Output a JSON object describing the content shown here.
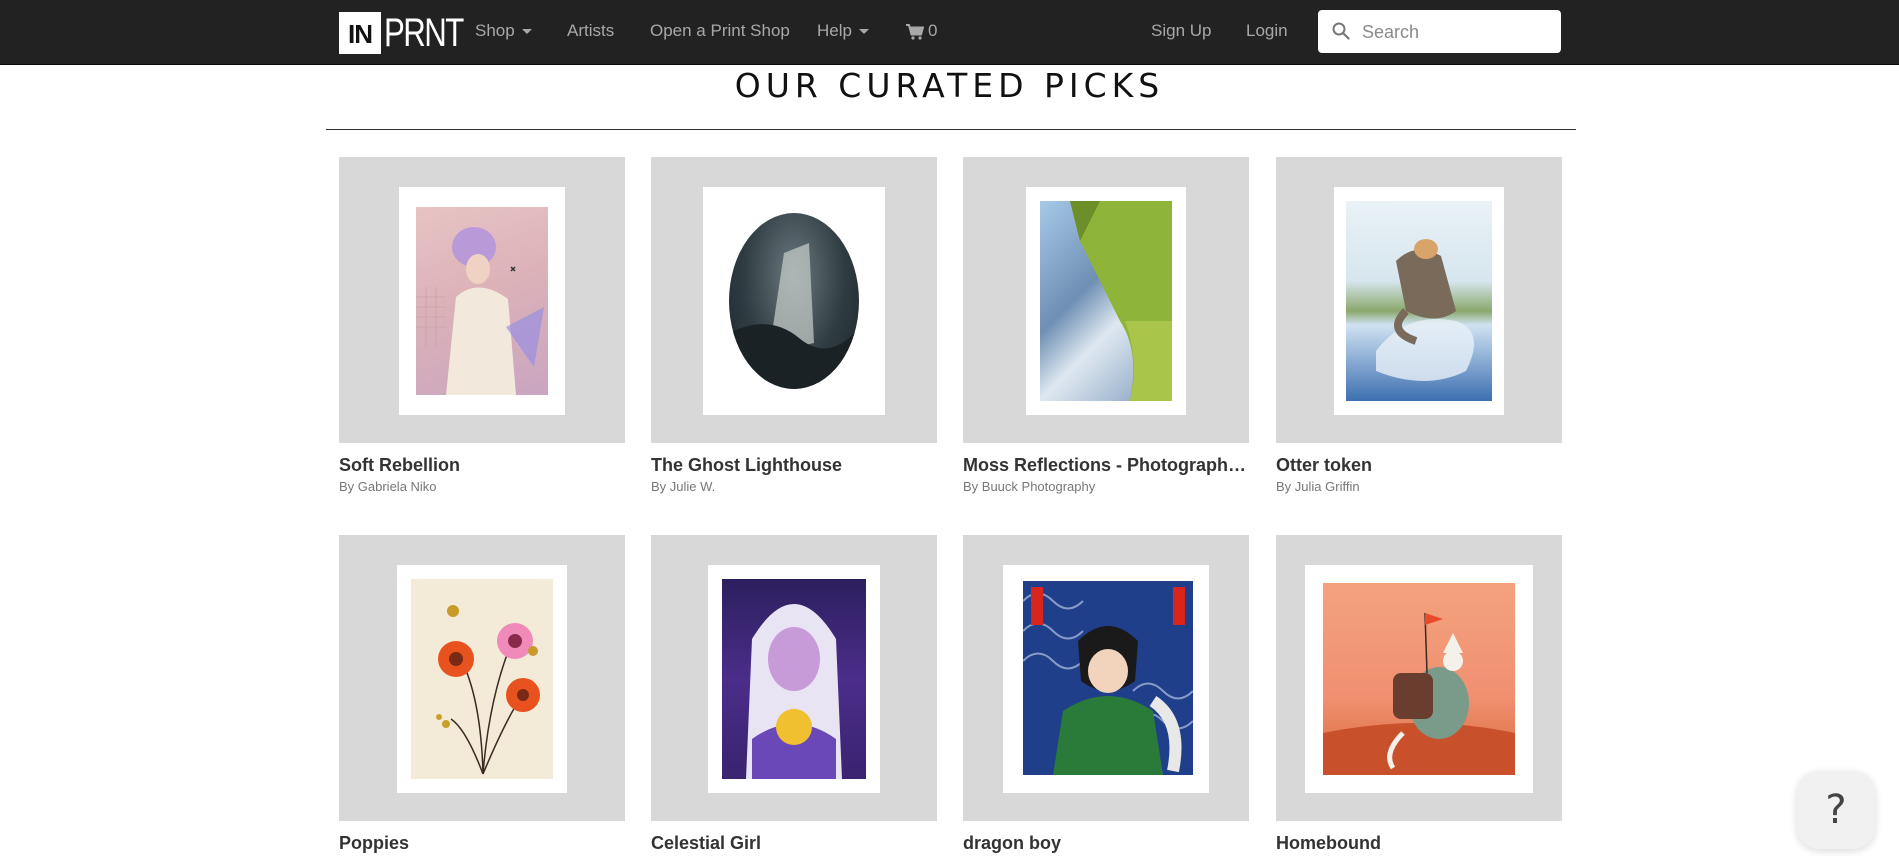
{
  "nav": {
    "logo_in": "IN",
    "logo_prnt": "PRNT",
    "shop": "Shop",
    "artists": "Artists",
    "open_shop": "Open a Print Shop",
    "help": "Help",
    "cart_count": "0",
    "sign_up": "Sign Up",
    "login": "Login",
    "search_placeholder": "Search"
  },
  "heading": "OUR CURATED PICKS",
  "cards": [
    {
      "title": "Soft Rebellion",
      "artist": "By Gabriela Niko"
    },
    {
      "title": "The Ghost Lighthouse",
      "artist": "By Julie W."
    },
    {
      "title": "Moss Reflections - Photography Print",
      "artist": "By Buuck Photography"
    },
    {
      "title": "Otter token",
      "artist": "By Julia Griffin"
    },
    {
      "title": "Poppies",
      "artist": ""
    },
    {
      "title": "Celestial Girl",
      "artist": ""
    },
    {
      "title": "dragon boy",
      "artist": ""
    },
    {
      "title": "Homebound",
      "artist": ""
    }
  ],
  "help_bubble": "?",
  "colors": {
    "navbar": "#222222",
    "frame": "#d8d8d8"
  }
}
